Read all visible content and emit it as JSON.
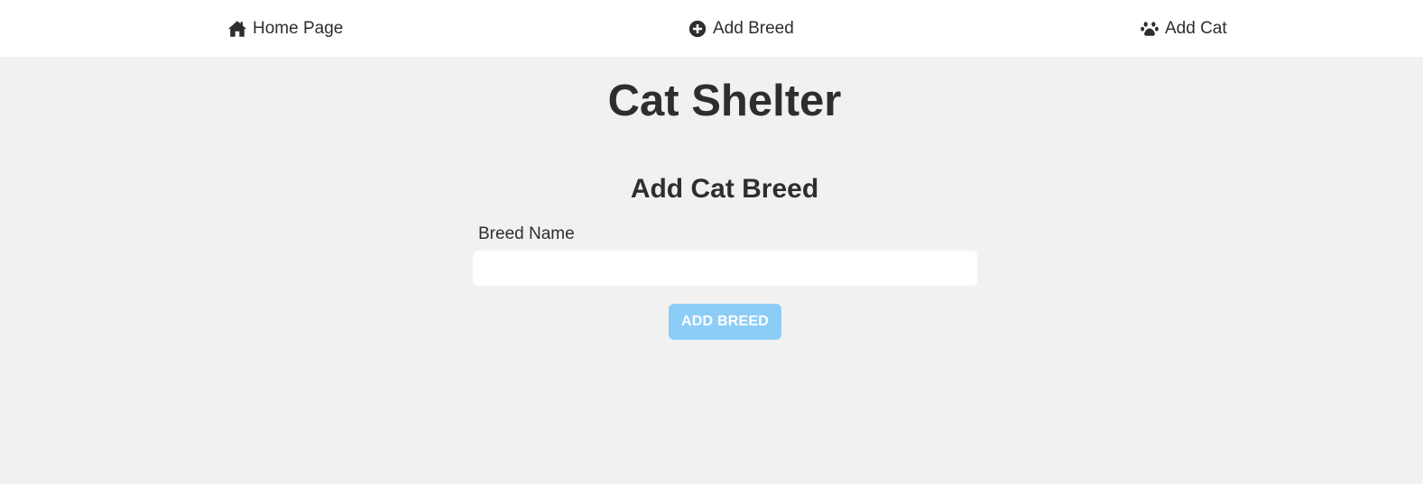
{
  "nav": {
    "items": [
      {
        "label": "Home Page",
        "icon": "home-icon"
      },
      {
        "label": "Add Breed",
        "icon": "plus-circle-icon"
      },
      {
        "label": "Add Cat",
        "icon": "paw-icon"
      }
    ]
  },
  "header": {
    "title": "Cat Shelter"
  },
  "form": {
    "title": "Add Cat Breed",
    "breed_label": "Breed Name",
    "breed_value": "",
    "breed_placeholder": "",
    "submit_label": "ADD BREED"
  },
  "colors": {
    "page_background": "#f1f1f1",
    "nav_background": "#ffffff",
    "text": "#2e2e2e",
    "button_accent": "#8ccdf8"
  }
}
